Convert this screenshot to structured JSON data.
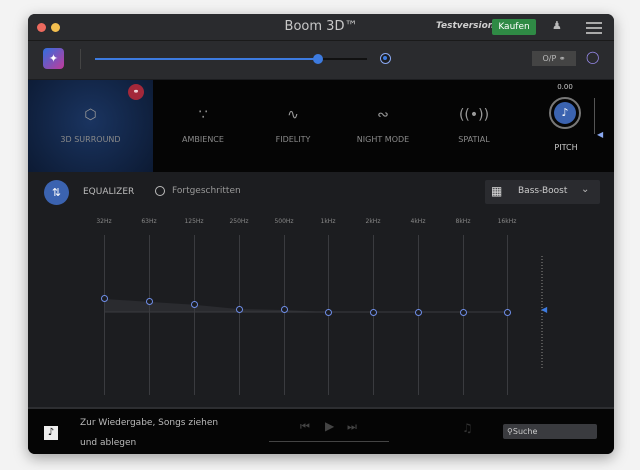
{
  "titlebar": {
    "title": "Boom 3D™",
    "trial": "Testversion",
    "buy": "Kaufen"
  },
  "toolbar": {
    "volume_percent": 82,
    "output_label": "O/P"
  },
  "effects": [
    {
      "label": "3D SURROUND",
      "icon": "cube-icon",
      "active": true
    },
    {
      "label": "AMBIENCE",
      "icon": "ambience-icon"
    },
    {
      "label": "FIDELITY",
      "icon": "waveform-icon"
    },
    {
      "label": "NIGHT MODE",
      "icon": "night-wave-icon"
    },
    {
      "label": "SPATIAL",
      "icon": "speaker-icon"
    }
  ],
  "pitch": {
    "label": "PITCH",
    "value": "0.00"
  },
  "equalizer": {
    "title": "EQUALIZER",
    "advanced": "Fortgeschritten",
    "preset": "Bass-Boost",
    "bands": [
      "32Hz",
      "63Hz",
      "125Hz",
      "250Hz",
      "500Hz",
      "1kHz",
      "2kHz",
      "4kHz",
      "8kHz",
      "16kHz"
    ],
    "gains_db": [
      4.5,
      3.5,
      2.5,
      1,
      0.7,
      0,
      0,
      0,
      0,
      0
    ]
  },
  "player": {
    "drop_text_1": "Zur Wiedergabe, Songs ziehen",
    "drop_text_2": "und ablegen",
    "search_placeholder": "Suche"
  },
  "colors": {
    "accent": "#3d7be0",
    "buy": "#2f8a45",
    "headphone_badge": "#a3283a"
  }
}
